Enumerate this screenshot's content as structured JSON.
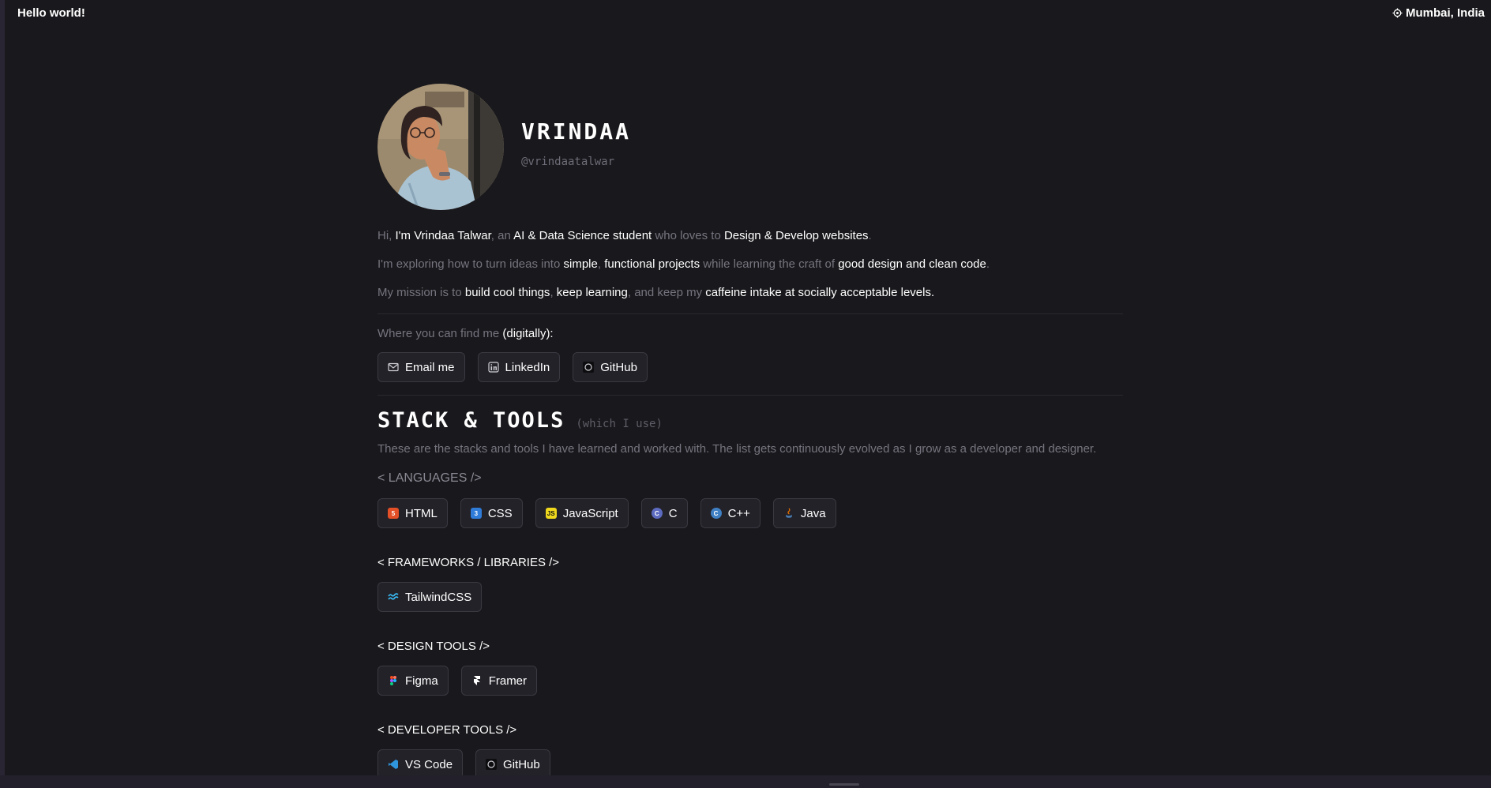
{
  "topbar": {
    "greeting": "Hello world!",
    "location": "Mumbai, India"
  },
  "profile": {
    "name": "VRINDAA",
    "handle": "@vrindaatalwar"
  },
  "intro": {
    "p1": [
      "Hi, ",
      "I'm Vrindaa Talwar",
      ", an ",
      "AI & Data Science student",
      " who loves to ",
      "Design & Develop websites",
      "."
    ],
    "p2": [
      "I'm exploring how to turn ideas into ",
      "simple",
      ", ",
      "functional projects",
      " while learning the craft of ",
      "good design and clean code",
      "."
    ],
    "p3": [
      "My mission is to ",
      "build cool things",
      ", ",
      "keep learning",
      ", and keep my ",
      "caffeine intake at socially acceptable levels."
    ]
  },
  "contact": {
    "label": "Where you can find me ",
    "label_highlight": "(digitally):",
    "links": [
      "Email me",
      "LinkedIn",
      "GitHub"
    ]
  },
  "stack": {
    "title": "STACK & TOOLS",
    "subtitle": "(which I use)",
    "description": "These are the stacks and tools I have learned and worked with. The list gets continuously evolved as I grow as a developer and designer.",
    "languages_label": "< LANGUAGES />",
    "languages": [
      "HTML",
      "CSS",
      "JavaScript",
      "C",
      "C++",
      "Java"
    ],
    "frameworks_label": "< FRAMEWORKS / LIBRARIES />",
    "frameworks": [
      "TailwindCSS"
    ],
    "design_label": "< DESIGN TOOLS />",
    "design": [
      "Figma",
      "Framer"
    ],
    "dev_label": "< DEVELOPER TOOLS />",
    "dev": [
      "VS Code",
      "GitHub"
    ]
  },
  "colors": {
    "background": "#19181c",
    "muted_text": "#76747f",
    "highlight_text": "#ffffff",
    "chip_border": "#3a3942"
  }
}
